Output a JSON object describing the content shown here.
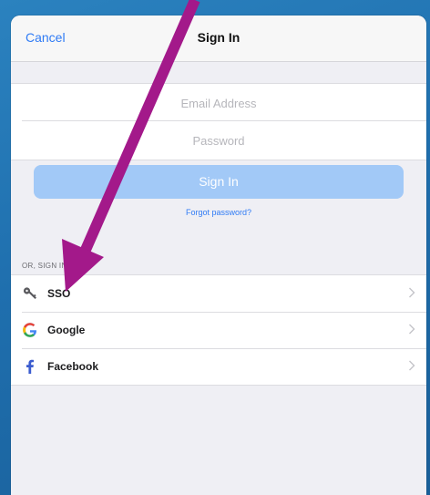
{
  "navbar": {
    "cancel_label": "Cancel",
    "title": "Sign In"
  },
  "form": {
    "email_placeholder": "Email Address",
    "email_value": "",
    "password_placeholder": "Password",
    "password_value": "",
    "signin_label": "Sign In",
    "forgot_label": "Forgot password?"
  },
  "alt_signin": {
    "header": "OR, SIGN IN WITH",
    "providers": [
      {
        "label": "SSO",
        "icon": "key-icon"
      },
      {
        "label": "Google",
        "icon": "google-icon"
      },
      {
        "label": "Facebook",
        "icon": "facebook-icon"
      }
    ]
  },
  "colors": {
    "accent_blue": "#2f7bf5",
    "signin_button_disabled": "#a2c9f7",
    "annotation_arrow": "#a3198a",
    "background_blue": "#1f6fae"
  },
  "annotation": {
    "icon": "annotation-arrow-icon"
  }
}
